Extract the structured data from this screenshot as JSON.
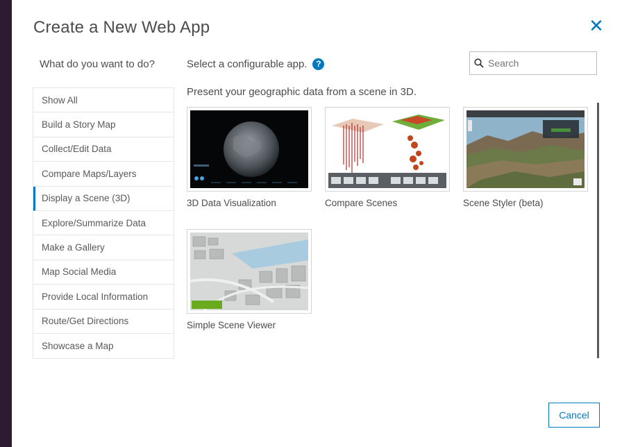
{
  "dialog": {
    "title": "Create a New Web App",
    "close_icon": "close-icon"
  },
  "sidebar": {
    "heading": "What do you want to do?",
    "items": [
      {
        "label": "Show All",
        "active": false
      },
      {
        "label": "Build a Story Map",
        "active": false
      },
      {
        "label": "Collect/Edit Data",
        "active": false
      },
      {
        "label": "Compare Maps/Layers",
        "active": false
      },
      {
        "label": "Display a Scene (3D)",
        "active": true
      },
      {
        "label": "Explore/Summarize Data",
        "active": false
      },
      {
        "label": "Make a Gallery",
        "active": false
      },
      {
        "label": "Map Social Media",
        "active": false
      },
      {
        "label": "Provide Local Information",
        "active": false
      },
      {
        "label": "Route/Get Directions",
        "active": false
      },
      {
        "label": "Showcase a Map",
        "active": false
      }
    ]
  },
  "main": {
    "heading": "Select a configurable app.",
    "help_icon": "help-icon",
    "section_description": "Present your geographic data from a scene in 3D.",
    "apps": [
      {
        "label": "3D Data Visualization",
        "thumbnail": "globe-scene-thumbnail"
      },
      {
        "label": "Compare Scenes",
        "thumbnail": "compare-scenes-thumbnail"
      },
      {
        "label": "Scene Styler (beta)",
        "thumbnail": "terrain-scene-thumbnail"
      },
      {
        "label": "Simple Scene Viewer",
        "thumbnail": "city-scene-thumbnail"
      }
    ]
  },
  "search": {
    "placeholder": "Search",
    "value": "",
    "icon": "search-icon"
  },
  "footer": {
    "cancel_label": "Cancel"
  },
  "colors": {
    "accent": "#0079c1",
    "backdrop": "#2d1b32",
    "text": "#4c4c4c"
  }
}
